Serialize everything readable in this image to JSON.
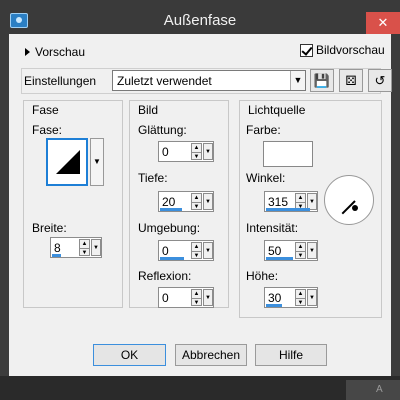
{
  "window": {
    "title": "Außenfase",
    "close_glyph": "✕",
    "app_icon": "app-icon",
    "background_partial_label": "A"
  },
  "top": {
    "preview_toggle_label": "Vorschau",
    "show_preview_label": "Bildvorschau",
    "show_preview_checked": true
  },
  "settings": {
    "label": "Einstellungen",
    "selected": "Zuletzt verwendet",
    "tool_buttons": [
      "save-preset-icon",
      "randomize-dice-icon",
      "reset-icon"
    ]
  },
  "fase": {
    "title": "Fase",
    "shape_label": "Fase:",
    "width_label": "Breite:",
    "width_value": "8"
  },
  "bild": {
    "title": "Bild",
    "smoothing_label": "Glättung:",
    "smoothing_value": "0",
    "depth_label": "Tiefe:",
    "depth_value": "20",
    "ambience_label": "Umgebung:",
    "ambience_value": "0",
    "shininess_label": "Reflexion:",
    "shininess_value": "0"
  },
  "light": {
    "title": "Lichtquelle",
    "color_label": "Farbe:",
    "color_value": "#ffffff",
    "angle_label": "Winkel:",
    "angle_value": "315",
    "intensity_label": "Intensität:",
    "intensity_value": "50",
    "elevation_label": "Höhe:",
    "elevation_value": "30"
  },
  "buttons": {
    "ok": "OK",
    "cancel": "Abbrechen",
    "help": "Hilfe"
  },
  "colors": {
    "accent": "#3c8fdd",
    "dialog_bg": "#f0f0f0",
    "close_red": "#d9514a"
  }
}
